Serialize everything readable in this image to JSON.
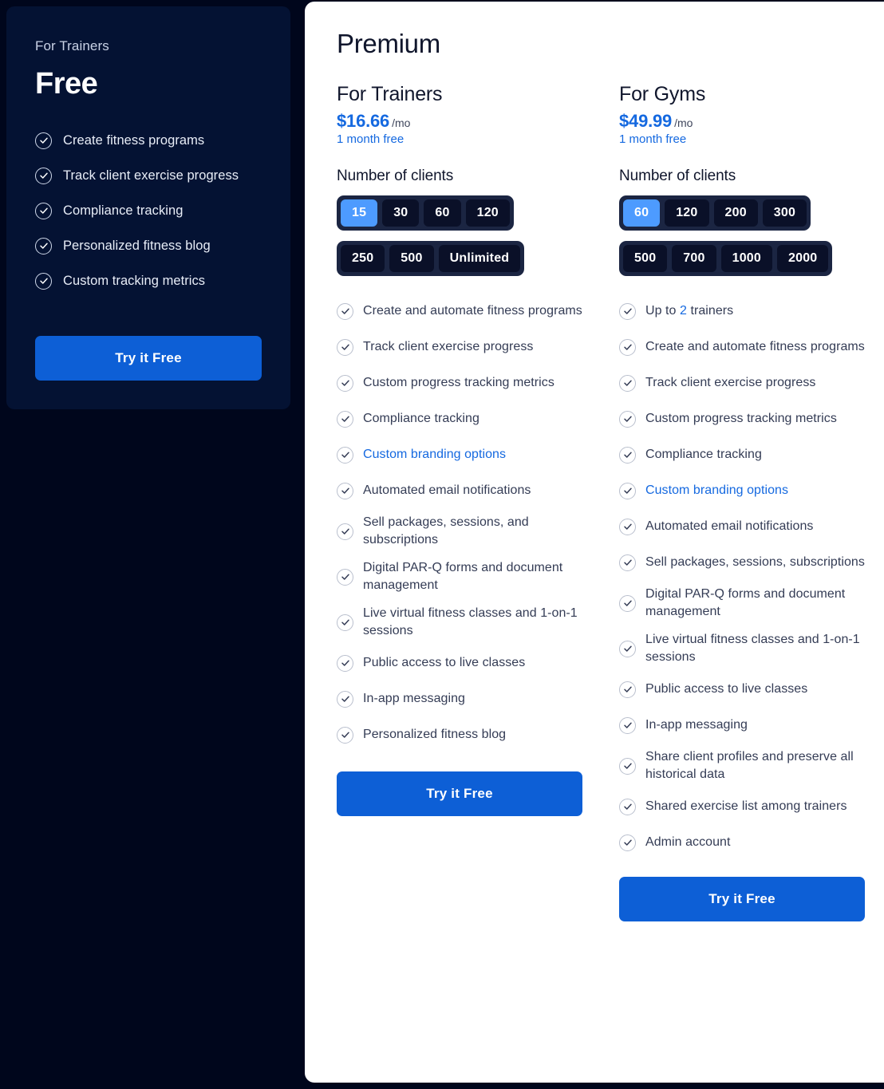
{
  "theme": {
    "page_bg": "#00061c",
    "free_card_bg": "#041233",
    "premium_card_bg": "#ffffff",
    "accent_blue": "#1569e0",
    "cta_blue": "#0d5fd6",
    "active_pill_blue": "#4d9bff"
  },
  "free_plan": {
    "eyebrow": "For Trainers",
    "title": "Free",
    "features": [
      "Create fitness programs",
      "Track client exercise progress",
      "Compliance tracking",
      "Personalized fitness blog",
      "Custom tracking metrics"
    ],
    "cta_label": "Try it Free"
  },
  "premium": {
    "title": "Premium",
    "columns": [
      {
        "id": "trainers",
        "title": "For Trainers",
        "price": "$16.66",
        "period": "/mo",
        "promo": "1 month free",
        "clients_label": "Number of clients",
        "client_options_row1": [
          "15",
          "30",
          "60",
          "120"
        ],
        "client_options_row2": [
          "250",
          "500",
          "Unlimited"
        ],
        "selected_clients": "15",
        "features": [
          {
            "text": "Create and automate fitness programs",
            "accent": false
          },
          {
            "text": "Track client exercise progress",
            "accent": false
          },
          {
            "text": "Custom progress tracking metrics",
            "accent": false
          },
          {
            "text": "Compliance tracking",
            "accent": false
          },
          {
            "text": "Custom branding options",
            "accent": true
          },
          {
            "text": "Automated email notifications",
            "accent": false
          },
          {
            "text": "Sell packages, sessions, and subscriptions",
            "accent": false
          },
          {
            "text": "Digital PAR-Q forms and document management",
            "accent": false
          },
          {
            "text": "Live virtual fitness classes and 1-on-1 sessions",
            "accent": false
          },
          {
            "text": "Public access to live classes",
            "accent": false
          },
          {
            "text": "In-app messaging",
            "accent": false
          },
          {
            "text": "Personalized fitness blog",
            "accent": false
          }
        ],
        "cta_label": "Try it Free"
      },
      {
        "id": "gyms",
        "title": "For Gyms",
        "price": "$49.99",
        "period": "/mo",
        "promo": "1 month free",
        "clients_label": "Number of clients",
        "client_options_row1": [
          "60",
          "120",
          "200",
          "300"
        ],
        "client_options_row2": [
          "500",
          "700",
          "1000",
          "2000"
        ],
        "selected_clients": "60",
        "features": [
          {
            "text": "Up to 2 trainers",
            "accent": false,
            "highlight": "2"
          },
          {
            "text": "Create and automate fitness programs",
            "accent": false
          },
          {
            "text": "Track client exercise progress",
            "accent": false
          },
          {
            "text": "Custom progress tracking metrics",
            "accent": false
          },
          {
            "text": "Compliance tracking",
            "accent": false
          },
          {
            "text": "Custom branding options",
            "accent": true
          },
          {
            "text": "Automated email notifications",
            "accent": false
          },
          {
            "text": "Sell packages, sessions, subscriptions",
            "accent": false
          },
          {
            "text": "Digital PAR-Q forms and document management",
            "accent": false
          },
          {
            "text": "Live virtual fitness classes and 1-on-1 sessions",
            "accent": false
          },
          {
            "text": "Public access to live classes",
            "accent": false
          },
          {
            "text": "In-app messaging",
            "accent": false
          },
          {
            "text": "Share client profiles and preserve all historical data",
            "accent": false
          },
          {
            "text": "Shared exercise list among trainers",
            "accent": false
          },
          {
            "text": "Admin account",
            "accent": false
          }
        ],
        "cta_label": "Try it Free"
      }
    ]
  }
}
